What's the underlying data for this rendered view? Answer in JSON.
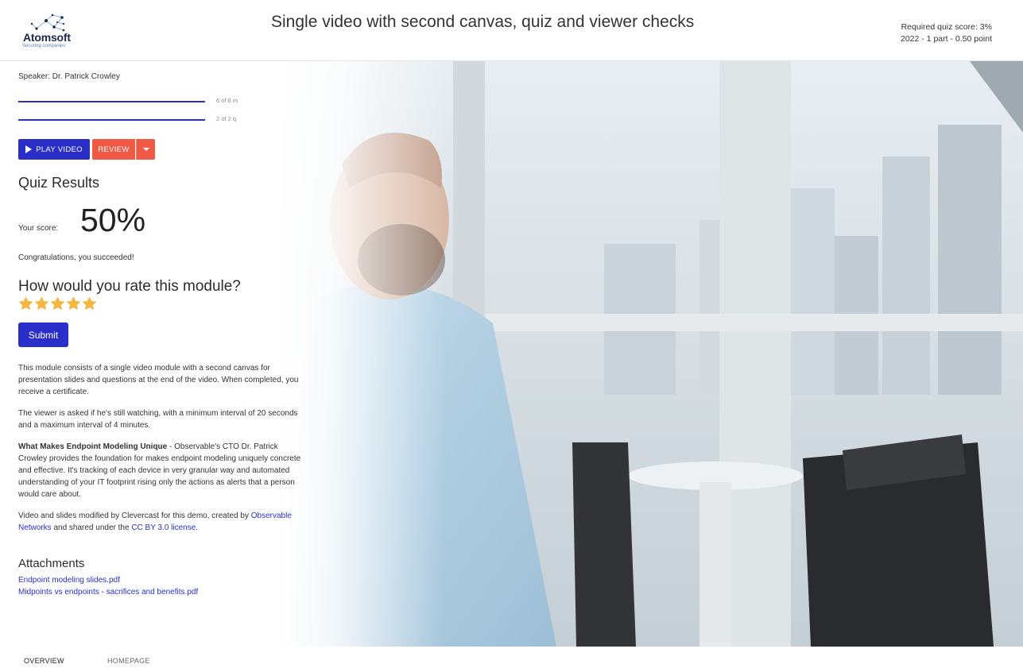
{
  "header": {
    "logo_name": "Atomsoft",
    "logo_tagline": "Securing companies",
    "title": "Single video with second canvas, quiz and viewer checks",
    "required_score": "Required quiz score: 3%",
    "points": "2022 - 1 part - 0.50 point"
  },
  "panel": {
    "speaker": "Speaker: Dr. Patrick Crowley",
    "progress": [
      {
        "label": "6 of 6 m",
        "fraction": 1.0
      },
      {
        "label": "2 of 2 q",
        "fraction": 1.0
      }
    ],
    "play_label": "PLAY VIDEO",
    "review_label": "REVIEW",
    "quiz_title": "Quiz Results",
    "score_label": "Your score:",
    "score_value": "50%",
    "congrats": "Congratulations, you succeeded!",
    "rate_title": "How would you rate this module?",
    "rating": 5,
    "submit_label": "Submit"
  },
  "description": {
    "p1": "This module consists of a single video module with a second canvas for presentation slides and questions at the end of the video. When completed, you receive a certificate.",
    "p2": "The viewer is asked if he's still watching, with a minimum interval of 20 seconds and a maximum interval of 4 minutes.",
    "p3_bold": "What Makes Endpoint Modeling Unique",
    "p3_rest": " - Observable's CTO Dr. Patrick Crowley provides the foundation for makes endpoint modeling uniquely concrete and effective. It's tracking of each device in very granular way and automated understanding of your IT footprint rising only the actions as alerts that a person would care about.",
    "p4_a": "Video and slides modified by Clevercast for this demo, created by ",
    "p4_link1": "Observable Networks",
    "p4_b": " and shared under the ",
    "p4_link2": "CC BY 3.0 license",
    "p4_c": "."
  },
  "attachments": {
    "title": "Attachments",
    "items": [
      "Endpoint modeling slides.pdf",
      "Midpoints vs endpoints - sacrifices and benefits.pdf"
    ]
  },
  "tabs": {
    "overview": "OVERVIEW",
    "homepage": "HOMEPAGE"
  },
  "colors": {
    "primary": "#2b2fc9",
    "review": "#f05a45",
    "star": "#f5b642"
  }
}
